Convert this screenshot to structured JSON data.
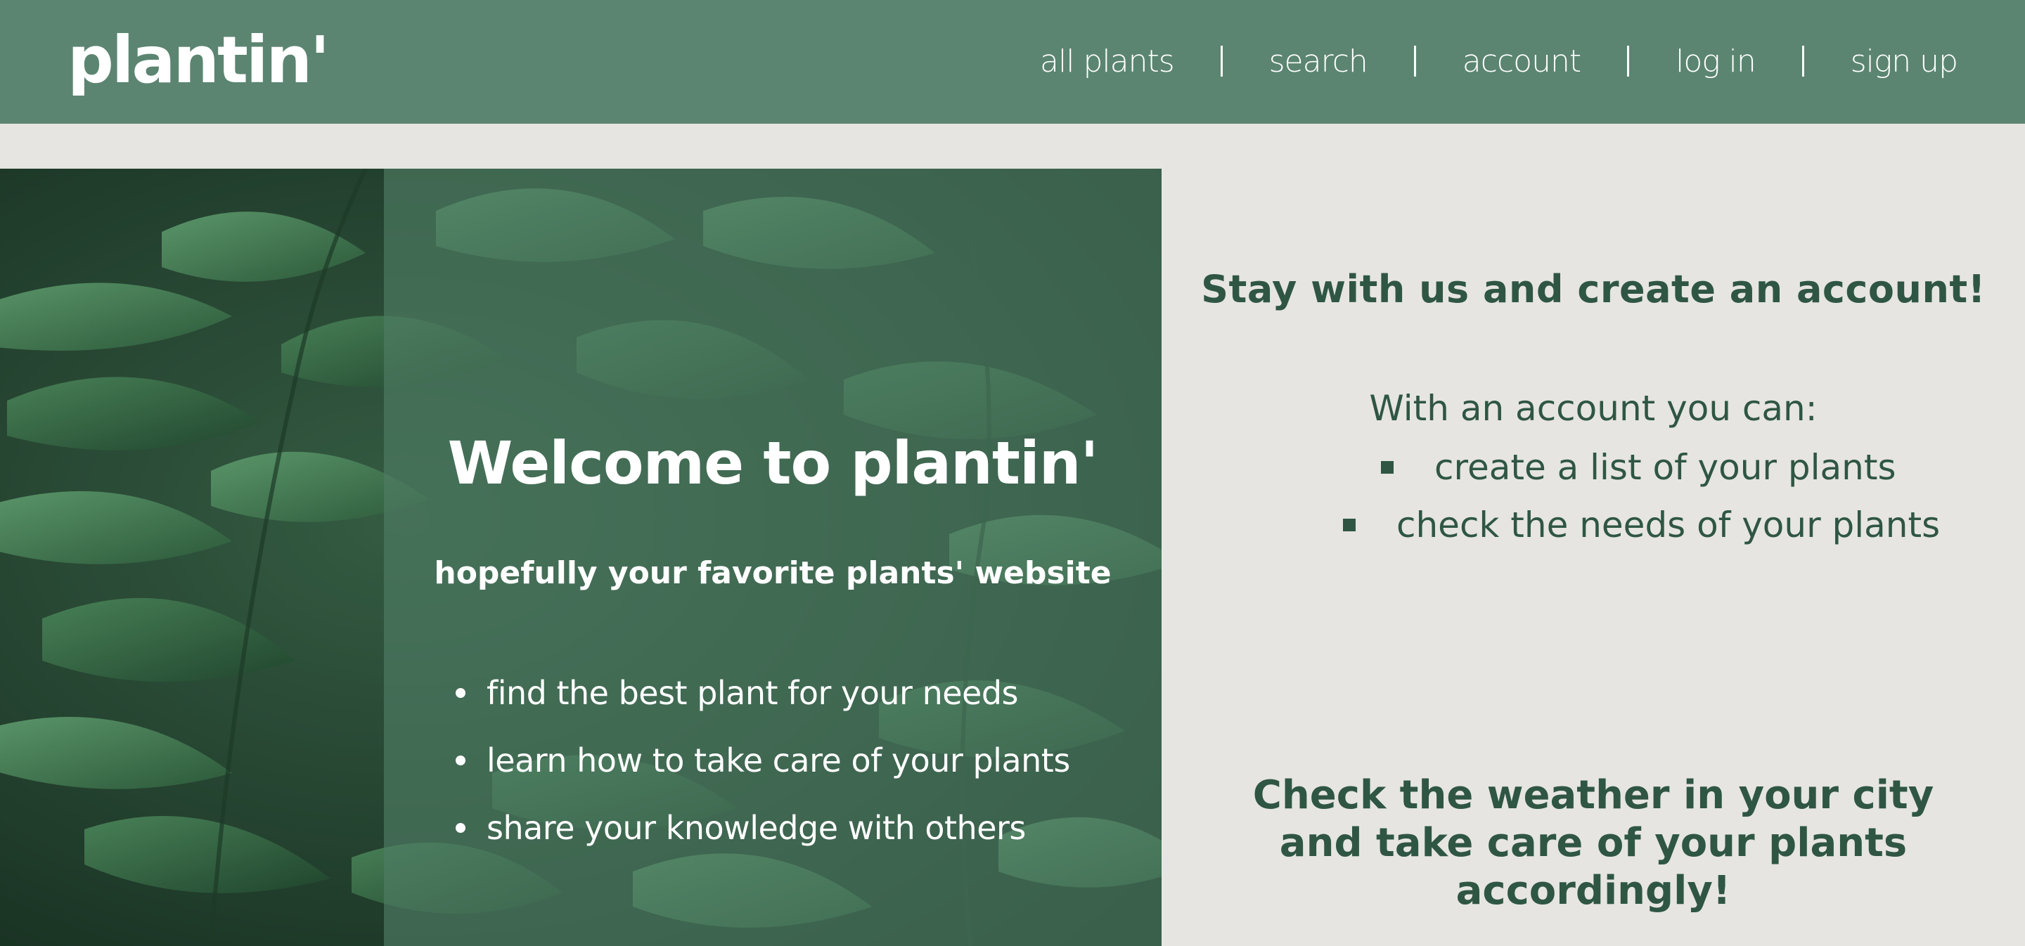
{
  "header": {
    "logo": "plantin'",
    "nav": [
      {
        "label": "all plants"
      },
      {
        "label": "search"
      },
      {
        "label": "account"
      },
      {
        "label": "log in"
      },
      {
        "label": "sign up"
      }
    ]
  },
  "hero": {
    "title": "Welcome to plantin'",
    "subtitle": "hopefully your favorite plants' website",
    "features": [
      "find the best plant for your needs",
      "learn how to take care of your plants",
      "share your knowledge with others"
    ]
  },
  "account": {
    "heading": "Stay with us and create an account!",
    "intro": "With an account you can:",
    "benefits": [
      "create a list of your plants",
      "check the needs of your plants"
    ]
  },
  "weather": {
    "line1": "Check the weather in your city",
    "line2": "and take care of your plants",
    "line3": "accordingly!"
  },
  "colors": {
    "nav_bg": "#5b8571",
    "page_bg": "#e6e5e1",
    "text_dark_green": "#2f5643",
    "overlay_green": "#4f7d64"
  }
}
